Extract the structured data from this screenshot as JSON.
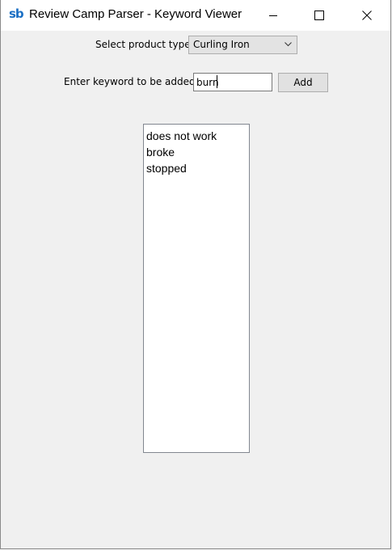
{
  "window": {
    "title": "Review Camp Parser - Keyword Viewer",
    "logo_text": "sb",
    "controls": {
      "minimize": "minimize-icon",
      "maximize": "maximize-icon",
      "close": "close-icon"
    }
  },
  "product": {
    "label": "Select product type",
    "selected": "Curling Iron"
  },
  "keyword": {
    "label": "Enter keyword to be added",
    "value": "burn",
    "add_label": "Add"
  },
  "keywords_list": {
    "items": [
      "does not work",
      "broke",
      "stopped"
    ]
  },
  "colors": {
    "logo": "#1a6fc4",
    "background": "#f0f0f0"
  }
}
